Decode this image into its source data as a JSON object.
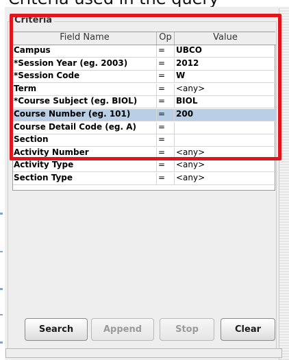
{
  "top_strip": {
    "text": "Criteria used in the query"
  },
  "criteria": {
    "title": "Criteria",
    "columns": [
      "Field Name",
      "Op",
      "Value"
    ],
    "rows": [
      {
        "field": "Campus",
        "op": "=",
        "value": "UBCO"
      },
      {
        "field": "*Session Year (eg. 2003)",
        "op": "=",
        "value": "2012"
      },
      {
        "field": "*Session Code",
        "op": "=",
        "value": "W"
      },
      {
        "field": "Term",
        "op": "=",
        "value": "<any>"
      },
      {
        "field": "*Course Subject (eg. BIOL)",
        "op": "=",
        "value": "BIOL"
      },
      {
        "field": "Course Number (eg. 101)",
        "op": "=",
        "value": "200",
        "selected": true
      },
      {
        "field": "Course Detail Code (eg. A)",
        "op": "=",
        "value": ""
      },
      {
        "field": "Section",
        "op": "=",
        "value": ""
      },
      {
        "field": "Activity Number",
        "op": "=",
        "value": "<any>"
      },
      {
        "field": "Activity Type",
        "op": "=",
        "value": "<any>"
      },
      {
        "field": "Section Type",
        "op": "=",
        "value": "<any>"
      }
    ]
  },
  "buttons": {
    "search": {
      "label": "Search",
      "enabled": true
    },
    "append": {
      "label": "Append",
      "enabled": false
    },
    "stop": {
      "label": "Stop",
      "enabled": false
    },
    "clear": {
      "label": "Clear",
      "enabled": true
    }
  },
  "colors": {
    "highlight_box": "#e0161c",
    "selected_row": "#b8cfe5",
    "panel_background": "#eeeeee"
  }
}
